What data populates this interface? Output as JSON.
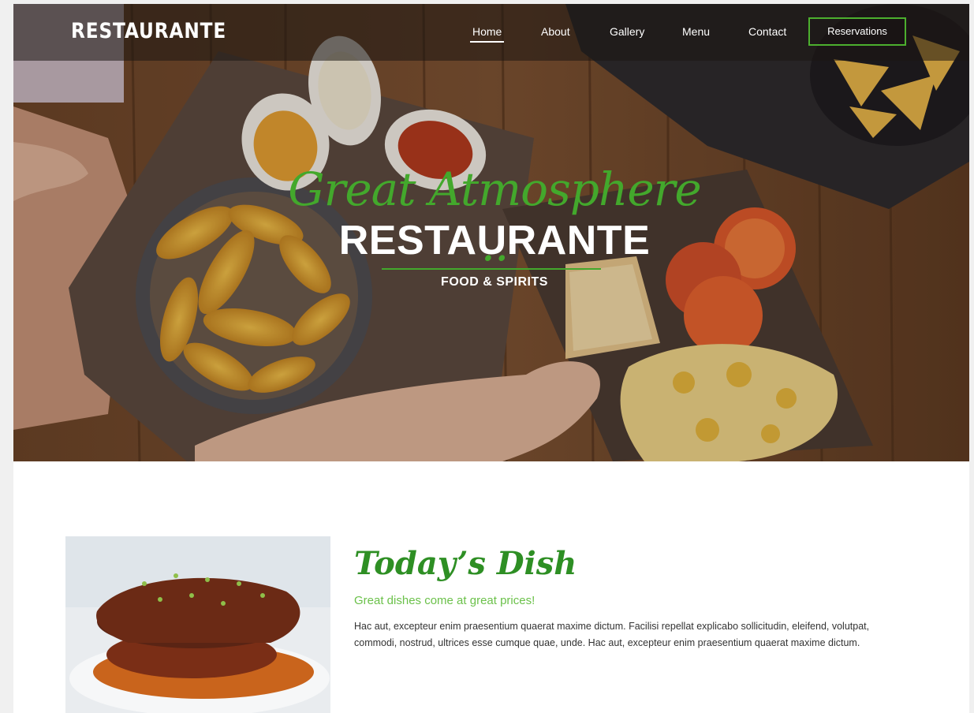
{
  "brand": {
    "logo": "RESTAURANTE"
  },
  "nav": {
    "items": [
      {
        "label": "Home",
        "active": true
      },
      {
        "label": "About",
        "active": false
      },
      {
        "label": "Gallery",
        "active": false
      },
      {
        "label": "Menu",
        "active": false
      },
      {
        "label": "Contact",
        "active": false
      }
    ],
    "reservations_label": "Reservations"
  },
  "hero": {
    "tagline": "Great Atmosphere ..",
    "title": "RESTAURANTE",
    "subtitle": "FOOD & SPIRITS"
  },
  "dish": {
    "title": "Today’s Dish",
    "subtitle": "Great dishes come at great prices!",
    "body": "Hac aut, excepteur enim praesentium quaerat maxime dictum. Facilisi repellat explicabo sollicitudin, eleifend, volutpat, commodi, nostrud, ultrices esse cumque quae, unde. Hac aut, excepteur enim praesentium quaerat maxime dictum."
  },
  "colors": {
    "accent": "#43a82c",
    "accent_light": "#6bc14a",
    "text": "#333333",
    "page_bg": "#ffffff"
  },
  "icons": {
    "hero_image": "food-table-photo",
    "dish_image": "steak-photo"
  }
}
